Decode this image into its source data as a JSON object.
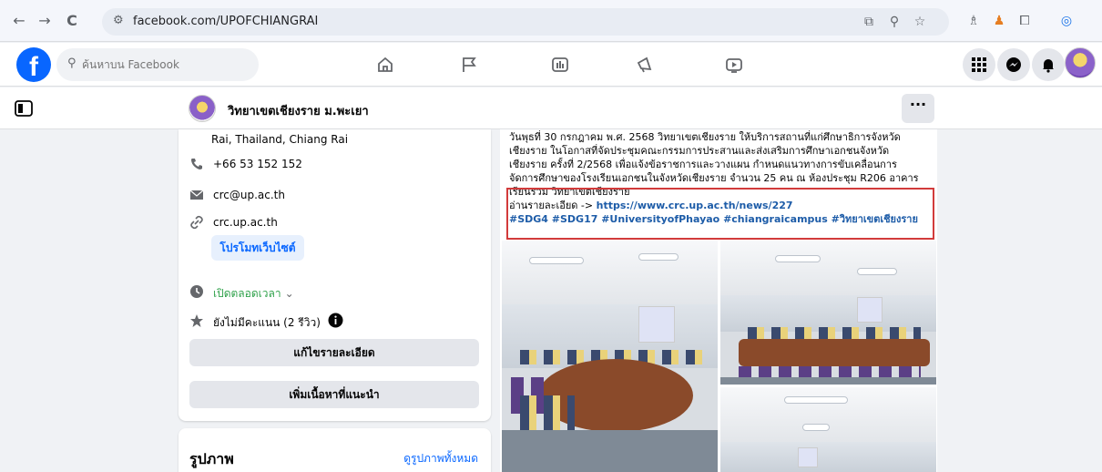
{
  "browser": {
    "url": "facebook.com/UPOFCHIANGRAI",
    "back_icon": "←",
    "forward_icon": "→",
    "reload_icon": "C",
    "site_info_icon": "⚙"
  },
  "fb": {
    "logo": "f",
    "search_placeholder": "ค้นหาบน Facebook",
    "nav_icons": [
      "home-icon",
      "flag-icon",
      "video-icon",
      "megaphone-icon",
      "gaming-icon"
    ],
    "right_icons": [
      "menu-grid-icon",
      "messenger-icon",
      "bell-icon"
    ]
  },
  "page": {
    "name": "วิทยาเขตเชียงราย ม.พะเยา",
    "more_label": "···"
  },
  "intro": {
    "address": "Rai, Thailand, Chiang Rai",
    "phone": "+66 53 152 152",
    "email": "crc@up.ac.th",
    "website": "crc.up.ac.th",
    "promote_label": "โปรโมทเว็บไซต์",
    "hours": "เปิดตลอดเวลา",
    "rating": "ยังไม่มีคะแนน (2 รีวิว)",
    "edit_details_label": "แก้ไขรายละเอียด",
    "add_featured_label": "เพิ่มเนื้อหาที่แนะนำ"
  },
  "photos": {
    "title": "รูปภาพ",
    "see_all": "ดูรูปภาพทั้งหมด"
  },
  "post": {
    "lines": [
      "วันพุธที่ 30 กรกฎาคม พ.ศ. 2568 วิทยาเขตเชียงราย ให้บริการสถานที่แก่ศึกษาธิการจังหวัด",
      "เชียงราย ในโอกาสที่จัดประชุมคณะกรรมการประสานและส่งเสริมการศึกษาเอกชนจังหวัด",
      "เชียงราย ครั้งที่ 2/2568 เพื่อแจ้งข้อราชการและวางแผน กำหนดแนวทางการขับเคลื่อนการ",
      "จัดการศึกษาของโรงเรียนเอกชนในจังหวัดเชียงราย จำนวน 25 คน ณ ห้องประชุม R206 อาคาร",
      "เรียนรวม วิทยาเขตเชียงราย"
    ],
    "read_more_prefix": "อ่านรายละเอียด -> ",
    "read_more_link": "https://www.crc.up.ac.th/news/227",
    "hashtags": "#SDG4  #SDG17 #UniversityofPhayao #chiangraicampus #วิทยาเขตเชียงราย"
  },
  "colors": {
    "fb_blue": "#0866ff",
    "highlight_red": "#d23b3b",
    "open_green": "#31a24c"
  }
}
